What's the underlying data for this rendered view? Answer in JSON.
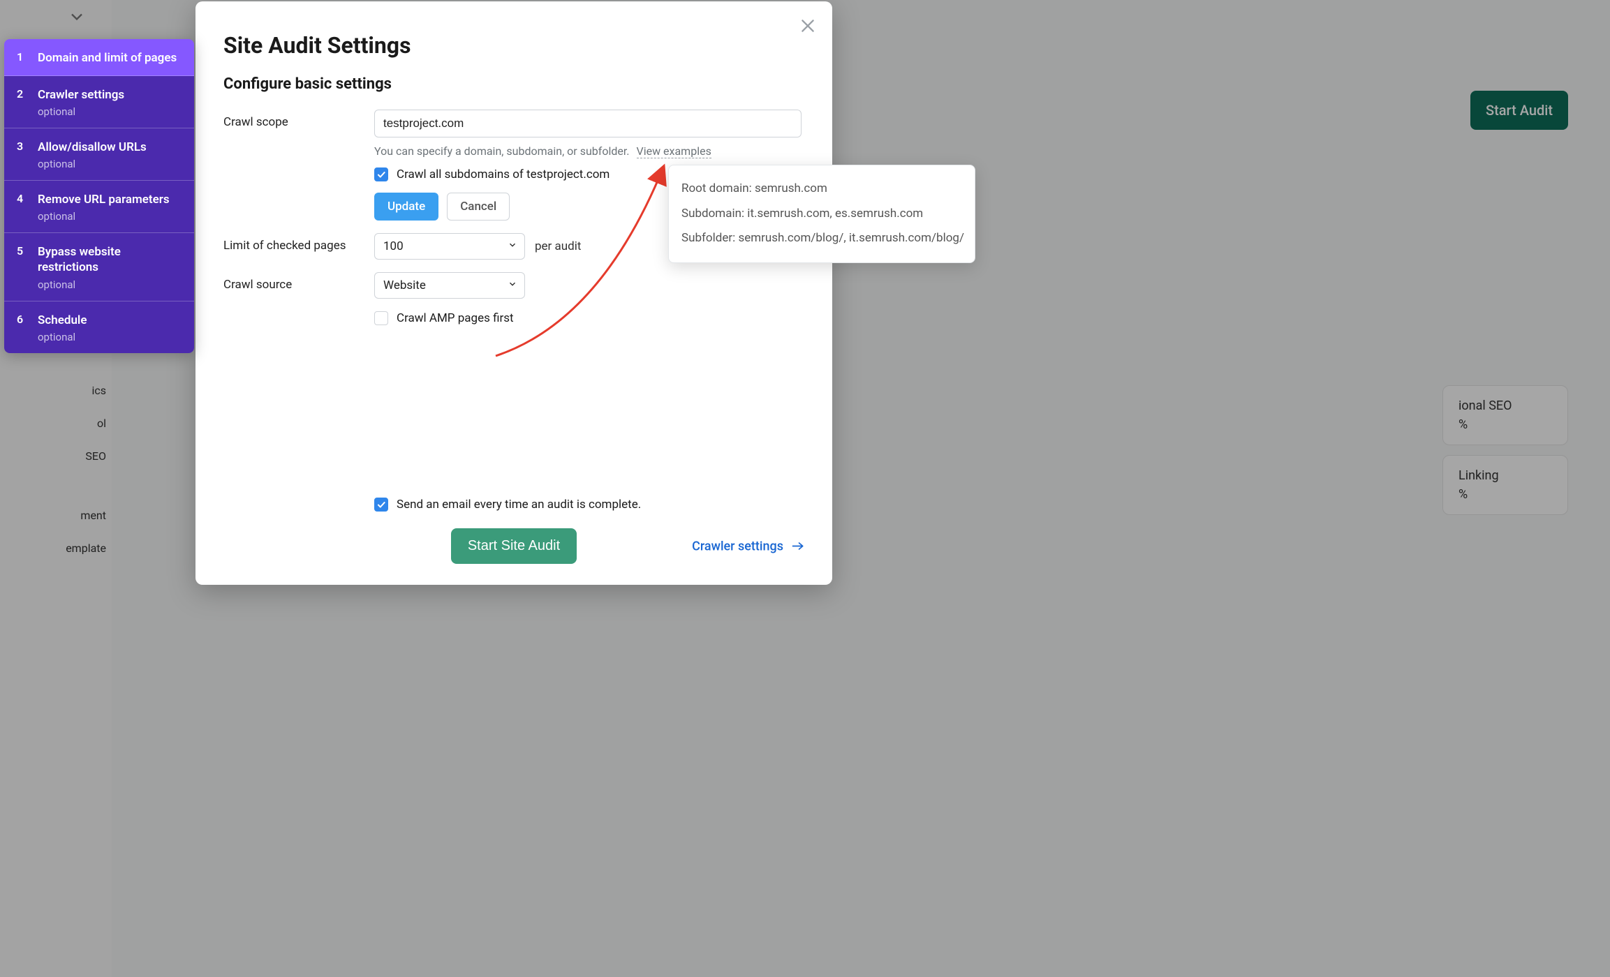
{
  "modal": {
    "title": "Site Audit Settings",
    "subtitle": "Configure basic settings",
    "crawl_scope_label": "Crawl scope",
    "crawl_scope_value": "testproject.com",
    "crawl_scope_hint": "You can specify a domain, subdomain, or subfolder.",
    "view_examples": "View examples",
    "crawl_all_label": "Crawl all subdomains of testproject.com",
    "crawl_all_checked": true,
    "update_label": "Update",
    "cancel_label": "Cancel",
    "limit_label": "Limit of checked pages",
    "limit_value": "100",
    "per_audit": "per audit",
    "crawl_source_label": "Crawl source",
    "crawl_source_value": "Website",
    "crawl_amp_label": "Crawl AMP pages first",
    "crawl_amp_checked": false,
    "email_label": "Send an email every time an audit is complete.",
    "email_checked": true,
    "start_button": "Start Site Audit",
    "next_link": "Crawler settings"
  },
  "steps": [
    {
      "n": "1",
      "label": "Domain and limit of pages",
      "optional": ""
    },
    {
      "n": "2",
      "label": "Crawler settings",
      "optional": "optional"
    },
    {
      "n": "3",
      "label": "Allow/disallow URLs",
      "optional": "optional"
    },
    {
      "n": "4",
      "label": "Remove URL parameters",
      "optional": "optional"
    },
    {
      "n": "5",
      "label": "Bypass website restrictions",
      "optional": "optional"
    },
    {
      "n": "6",
      "label": "Schedule",
      "optional": "optional"
    }
  ],
  "tooltip": {
    "line1": "Root domain: semrush.com",
    "line2": "Subdomain: it.semrush.com, es.semrush.com",
    "line3": "Subfolder: semrush.com/blog/, it.semrush.com/blog/"
  },
  "background": {
    "start_audit": "Start Audit",
    "nav0": "ics",
    "nav1": "ol",
    "nav2": "SEO",
    "nav3": "ment",
    "nav4": "emplate",
    "card1_title": "ional SEO",
    "card1_pct": "%",
    "card2_title": "Linking",
    "card2_pct": "%"
  }
}
